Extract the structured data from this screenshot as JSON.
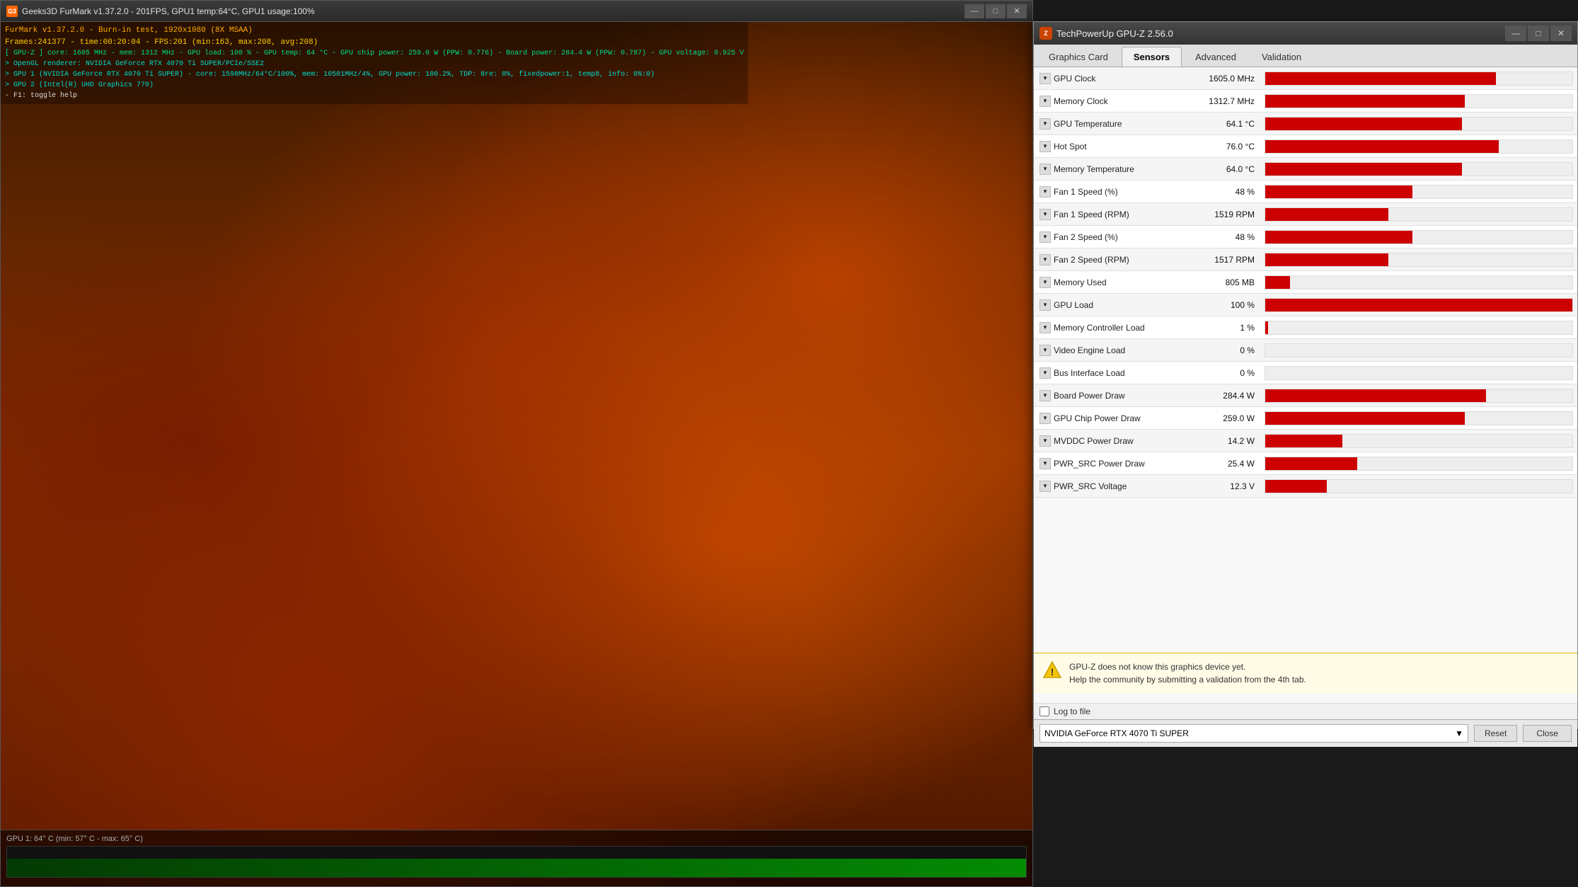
{
  "furmark": {
    "title": "Geeks3D FurMark v1.37.2.0 - 201FPS, GPU1 temp:64°C, GPU1 usage:100%",
    "overlay": {
      "line1": "FurMark v1.37.2.0 - Burn-in test, 1920x1080 (8X MSAA)",
      "line2": "Frames:241377 - time:00:20:04 - FPS:201 (min:163, max:208, avg:208)",
      "line3": "[ GPU-Z ] core: 1605 MHz - mem: 1312 MHz - GPU load: 100 % - GPU temp: 64 °C - GPU chip power: 259.0 W (PPW: 0.776) - Board power: 284.4 W (PPW: 0.787) - GPU voltage: 0.925 V",
      "line4": "> OpenGL renderer: NVIDIA GeForce RTX 4070 Ti SUPER/PCIe/SSE2",
      "line5": "> GPU 1 (NVIDIA GeForce RTX 4070 Ti SUPER) - core: 1598MHz/64°C/100%, mem: 10501MHz/4%, GPU power: 100.2%, TDP: 8re: 0%, fixedpower:1, temp8, info: 0%:0)",
      "line6": "> GPU 2 (Intel(R) UHD Graphics 770)",
      "line7": "- F1: toggle help"
    },
    "gpu_temp_label": "GPU 1: 64° C (min: 57° C - max: 65° C)"
  },
  "gpuz": {
    "title": "TechPowerUp GPU-Z 2.56.0",
    "tabs": [
      {
        "label": "Graphics Card",
        "active": false
      },
      {
        "label": "Sensors",
        "active": true
      },
      {
        "label": "Advanced",
        "active": false
      },
      {
        "label": "Validation",
        "active": false
      }
    ],
    "sensors": [
      {
        "name": "GPU Clock",
        "value": "1605.0 MHz",
        "bar_pct": 75
      },
      {
        "name": "Memory Clock",
        "value": "1312.7 MHz",
        "bar_pct": 65
      },
      {
        "name": "GPU Temperature",
        "value": "64.1 °C",
        "bar_pct": 64
      },
      {
        "name": "Hot Spot",
        "value": "76.0 °C",
        "bar_pct": 76
      },
      {
        "name": "Memory Temperature",
        "value": "64.0 °C",
        "bar_pct": 64
      },
      {
        "name": "Fan 1 Speed (%)",
        "value": "48 %",
        "bar_pct": 48
      },
      {
        "name": "Fan 1 Speed (RPM)",
        "value": "1519 RPM",
        "bar_pct": 40
      },
      {
        "name": "Fan 2 Speed (%)",
        "value": "48 %",
        "bar_pct": 48
      },
      {
        "name": "Fan 2 Speed (RPM)",
        "value": "1517 RPM",
        "bar_pct": 40
      },
      {
        "name": "Memory Used",
        "value": "805 MB",
        "bar_pct": 8
      },
      {
        "name": "GPU Load",
        "value": "100 %",
        "bar_pct": 100
      },
      {
        "name": "Memory Controller Load",
        "value": "1 %",
        "bar_pct": 1
      },
      {
        "name": "Video Engine Load",
        "value": "0 %",
        "bar_pct": 0
      },
      {
        "name": "Bus Interface Load",
        "value": "0 %",
        "bar_pct": 0
      },
      {
        "name": "Board Power Draw",
        "value": "284.4 W",
        "bar_pct": 72
      },
      {
        "name": "GPU Chip Power Draw",
        "value": "259.0 W",
        "bar_pct": 65
      },
      {
        "name": "MVDDC Power Draw",
        "value": "14.2 W",
        "bar_pct": 25
      },
      {
        "name": "PWR_SRC Power Draw",
        "value": "25.4 W",
        "bar_pct": 30
      },
      {
        "name": "PWR_SRC Voltage",
        "value": "12.3 V",
        "bar_pct": 20
      }
    ],
    "log_label": "Log to file",
    "dropdown_value": "NVIDIA GeForce RTX 4070 Ti SUPER",
    "reset_label": "Reset",
    "close_label": "Close",
    "notice": {
      "text1": "GPU-Z does not know this graphics device yet.",
      "text2": "Help the community by submitting a validation from the 4th tab."
    }
  }
}
